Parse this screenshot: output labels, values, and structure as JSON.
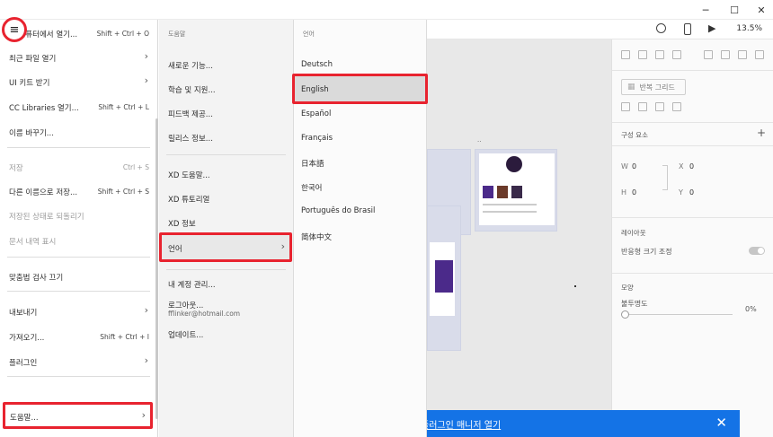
{
  "window": {
    "minimize": "─",
    "maximize": "☐",
    "close": "✕"
  },
  "toolbar": {
    "zoom": "13.5%"
  },
  "file_menu": {
    "items": [
      {
        "label": "내 컴퓨터에서 열기...",
        "shortcut": "Shift + Ctrl + O"
      },
      {
        "label": "최근 파일 열기",
        "submenu": true
      },
      {
        "label": "UI 키트 받기",
        "submenu": true
      },
      {
        "label": "CC Libraries 열기...",
        "shortcut": "Shift + Ctrl + L"
      },
      {
        "label": "이름 바꾸기..."
      },
      {
        "label": "저장",
        "shortcut": "Ctrl + S",
        "disabled": true
      },
      {
        "label": "다른 이름으로 저장...",
        "shortcut": "Shift + Ctrl + S"
      },
      {
        "label": "저장된 상태로 되돌리기",
        "disabled": true
      },
      {
        "label": "문서 내역 표시",
        "disabled": true
      },
      {
        "label": "맞춤법 검사 끄기"
      },
      {
        "label": "내보내기",
        "submenu": true
      },
      {
        "label": "가져오기...",
        "shortcut": "Shift + Ctrl + I"
      },
      {
        "label": "플러그인",
        "submenu": true
      },
      {
        "label": "도움말...",
        "submenu": true
      }
    ]
  },
  "help_menu": {
    "header": "도움말",
    "items": [
      {
        "label": "새로운 기능..."
      },
      {
        "label": "학습 및 지원..."
      },
      {
        "label": "피드백 제공..."
      },
      {
        "label": "릴리스 정보..."
      },
      {
        "label": "XD 도움말..."
      },
      {
        "label": "XD 튜토리얼"
      },
      {
        "label": "XD 정보"
      },
      {
        "label": "언어",
        "submenu": true
      },
      {
        "label": "내 계정 관리..."
      },
      {
        "label": "로그아웃...",
        "sub": "fflinker@hotmail.com"
      },
      {
        "label": "업데이트..."
      }
    ]
  },
  "language_menu": {
    "header": "언어",
    "items": [
      "Deutsch",
      "English",
      "Español",
      "Français",
      "日本語",
      "한국어",
      "Português do Brasil",
      "简体中文"
    ],
    "selected": "English"
  },
  "right_panel": {
    "repeat_grid": "반복 그리드",
    "components": "구성 요소",
    "w_label": "W",
    "w_value": "0",
    "x_label": "X",
    "x_value": "0",
    "h_label": "H",
    "h_value": "0",
    "y_label": "Y",
    "y_value": "0",
    "layout": "레이아웃",
    "responsive": "반응형 크기 조정",
    "appearance": "모양",
    "opacity": "불투명도",
    "opacity_value": "0%"
  },
  "banner": {
    "text": "플러그인 매니저 열기",
    "close": "✕"
  },
  "colors": {
    "highlight": "#e8232f",
    "banner": "#1473e6",
    "artboard": "#d9dcea",
    "purple": "#4b2a8a"
  }
}
